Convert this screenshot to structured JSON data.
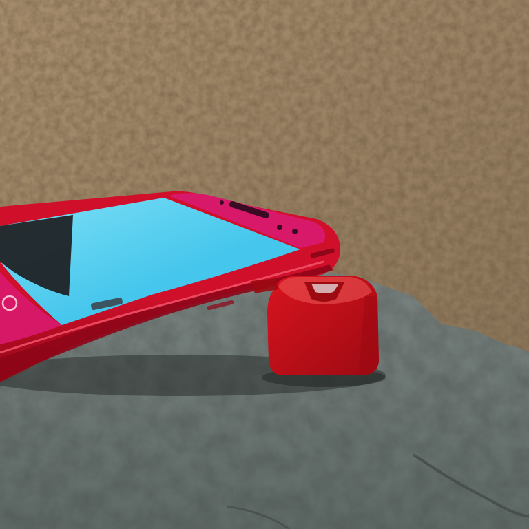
{
  "scene": {
    "subject": "phone",
    "colors": {
      "wall": "#8b7559",
      "wall_dark": "#6e5a42",
      "wall_light": "#a68d6d",
      "stone": "#5f6966",
      "stone_dark": "#434b49",
      "stone_light": "#7f8884",
      "phone_body": "#d0102a",
      "phone_body_dark": "#8e0618",
      "phone_highlight": "#f2546a",
      "bezel_top": "#d8196a",
      "screen": "#45c6ec",
      "screen_light": "#7fe0f6",
      "screen_dark_area": "#1d1d1f",
      "speaker": "#3a0b22",
      "cap": "#d9141f",
      "cap_dark": "#9c0a12",
      "cap_highlight": "#ef5a5a"
    }
  }
}
